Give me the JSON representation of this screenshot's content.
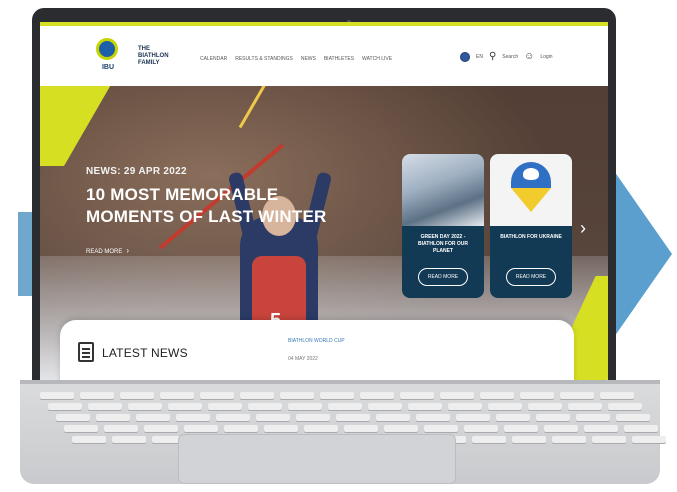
{
  "site": {
    "logo": "IBU",
    "family_line1": "THE",
    "family_line2": "BIATHLON",
    "family_line3": "FAMILY"
  },
  "nav": {
    "items": [
      "CALENDAR",
      "RESULTS & STANDINGS",
      "NEWS",
      "BIATHLETES",
      "WATCH LIVE"
    ],
    "lang": "EN",
    "search": "Search",
    "login": "Login"
  },
  "hero": {
    "news_date": "NEWS: 29 APR 2022",
    "headline": "10 MOST MEMORABLE MOMENTS OF LAST WINTER",
    "read_more": "READ MORE",
    "bib_number": "5"
  },
  "cards": [
    {
      "title": "GREEN DAY 2022 - BIATHLON FOR OUR PLANET",
      "button": "READ MORE"
    },
    {
      "title": "BIATHLON FOR UKRAINE",
      "button": "READ MORE"
    }
  ],
  "latest_news": {
    "title": "LATEST NEWS",
    "item_title": "BIATHLON WORLD CUP",
    "item_date": "04 MAY 2022"
  },
  "colors": {
    "accent_lime": "#d7df23",
    "card_navy": "#133a55",
    "arrow_blue": "#6fa7cc"
  }
}
